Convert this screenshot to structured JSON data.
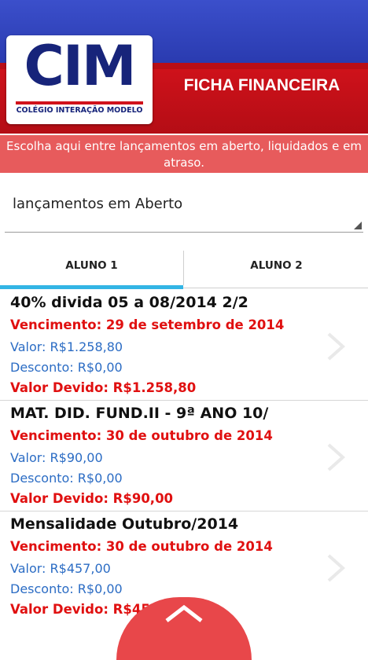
{
  "header": {
    "logo_letters": "CIM",
    "logo_tagline": "COLÉGIO INTERAÇÃO MODELO",
    "title": "FICHA FINANCEIRA"
  },
  "banner": {
    "text": "Escolha aqui entre lançamentos em aberto, liquidados e em atraso."
  },
  "filter": {
    "selected": "lançamentos em Aberto"
  },
  "tabs": [
    {
      "label": "ALUNO 1",
      "active": true
    },
    {
      "label": "ALUNO 2",
      "active": false
    }
  ],
  "items": [
    {
      "title": "40% divida 05 a 08/2014 2/2",
      "vencimento": "Vencimento: 29 de setembro de 2014",
      "valor": "Valor: R$1.258,80",
      "desconto": "Desconto: R$0,00",
      "devido": "Valor Devido: R$1.258,80"
    },
    {
      "title": "MAT. DID. FUND.II - 9ª ANO 10/",
      "vencimento": "Vencimento: 30 de outubro de 2014",
      "valor": "Valor: R$90,00",
      "desconto": "Desconto: R$0,00",
      "devido": "Valor Devido: R$90,00"
    },
    {
      "title": "Mensalidade Outubro/2014",
      "vencimento": "Vencimento: 30 de outubro de 2014",
      "valor": "Valor: R$457,00",
      "desconto": "Desconto: R$0,00",
      "devido": "Valor Devido: R$457,00"
    }
  ],
  "icons": {
    "row_chevron": "chevron-right-icon",
    "scroll_top": "chevron-up-icon"
  },
  "colors": {
    "header_blue": "#2a3bb0",
    "header_red": "#d1121b",
    "banner": "#e75b5c",
    "tab_indicator": "#33b5e5",
    "due_red": "#e01010",
    "value_blue": "#2b6cc4"
  }
}
